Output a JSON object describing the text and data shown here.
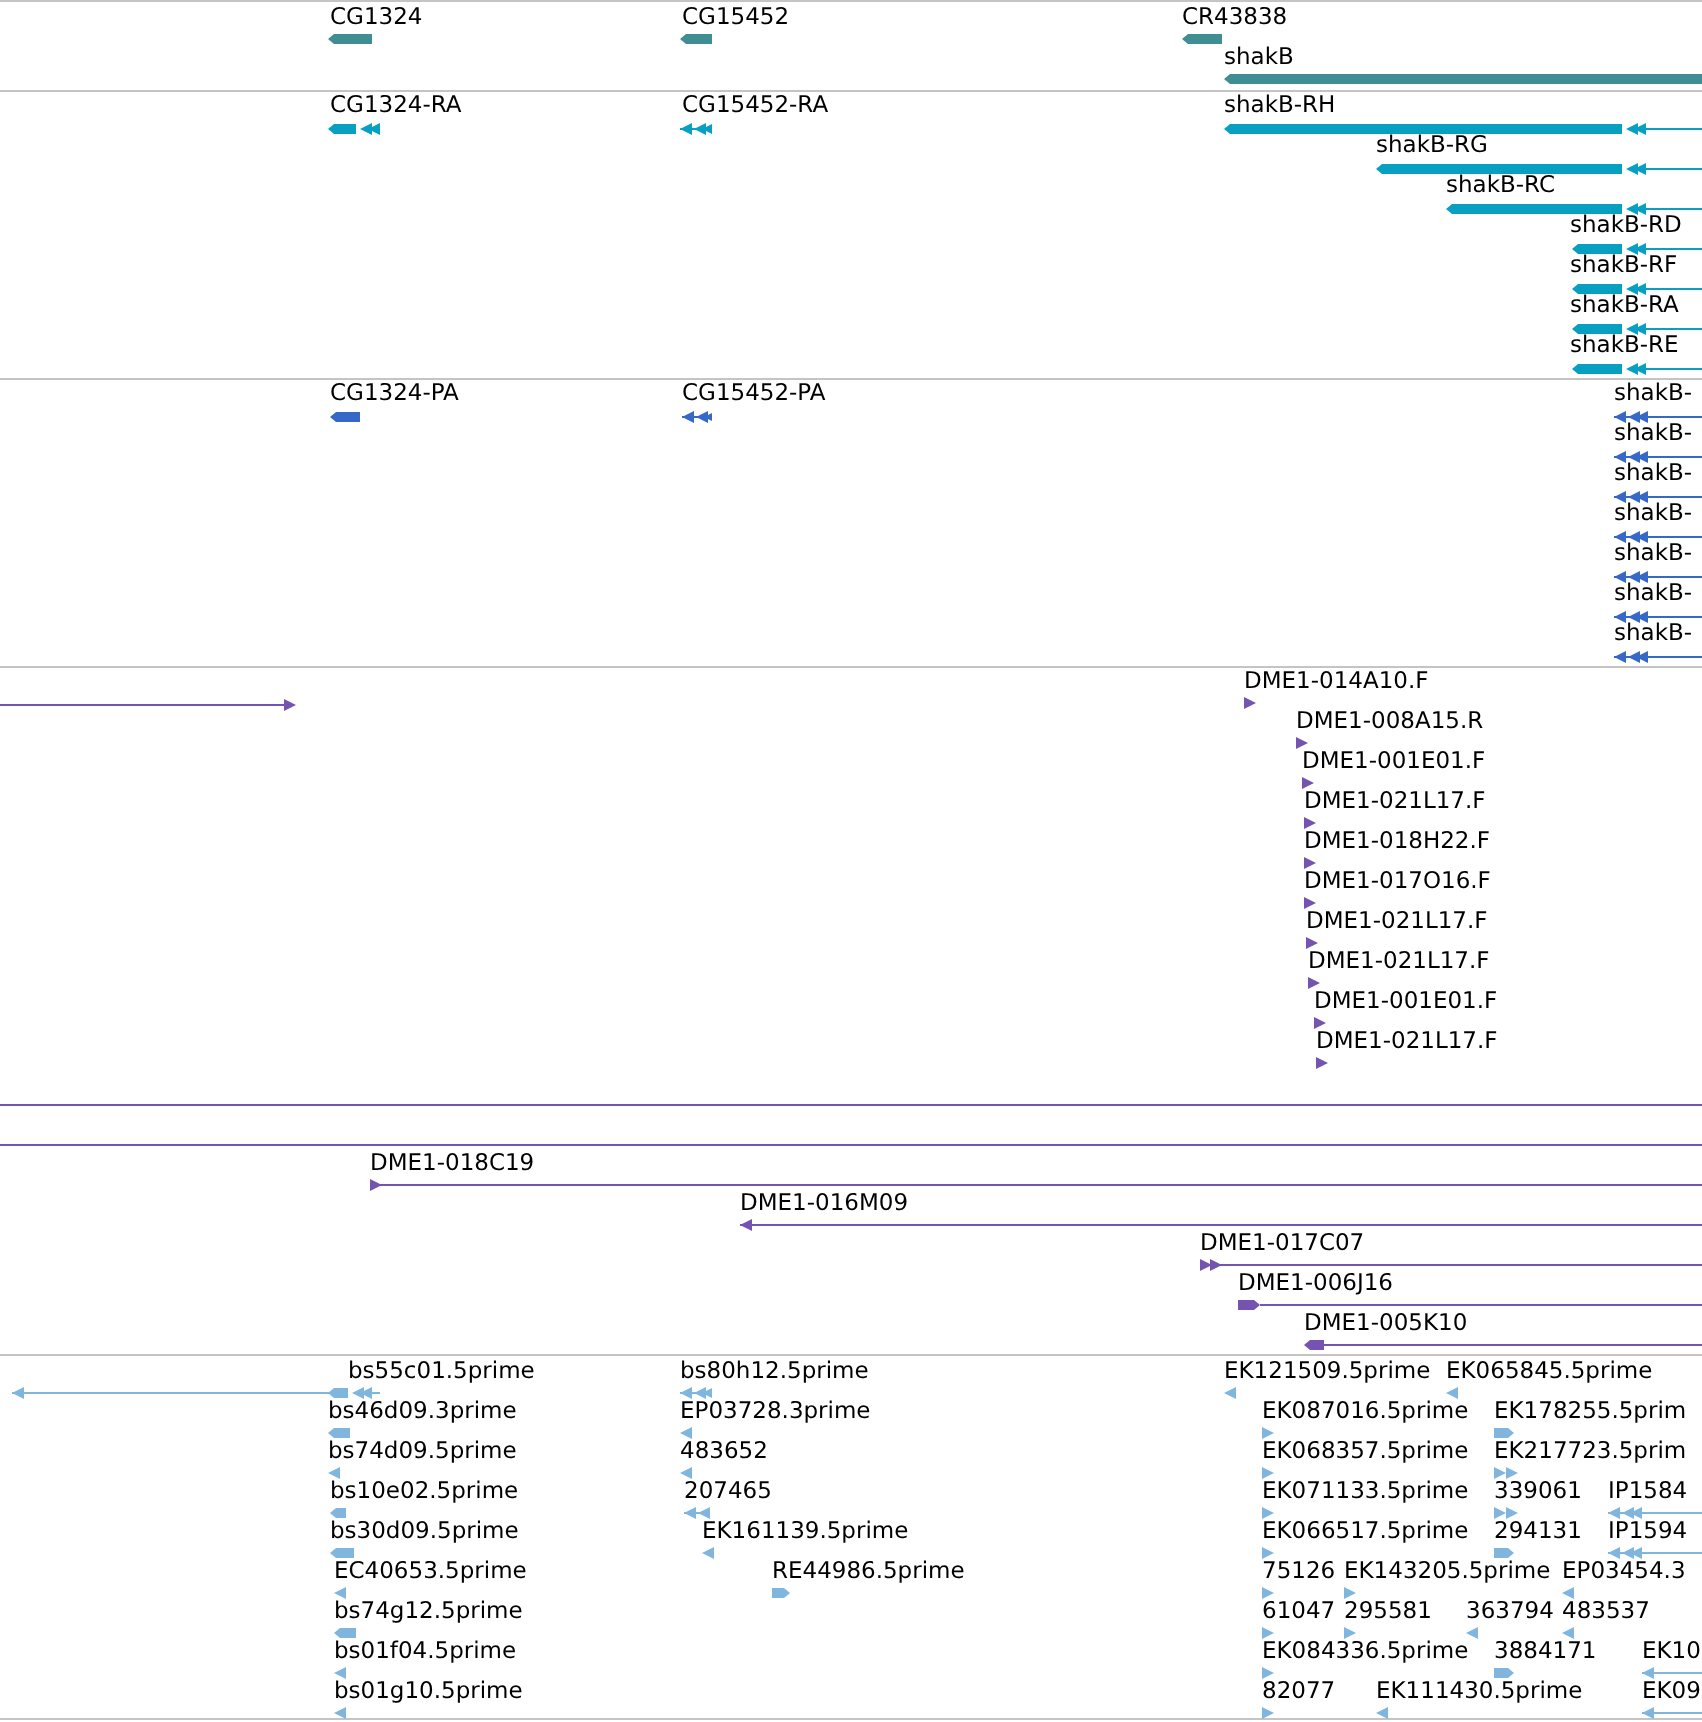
{
  "tracks": [
    {
      "color": "#3e8e94",
      "features": [
        {
          "label": "CG1324"
        },
        {
          "label": "CG15452"
        },
        {
          "label": "CR43838"
        },
        {
          "label": "shakB"
        }
      ]
    },
    {
      "color": "#08a0c2",
      "features": [
        {
          "label": "CG1324-RA"
        },
        {
          "label": "CG15452-RA"
        },
        {
          "label": "shakB-RH"
        },
        {
          "label": "shakB-RG"
        },
        {
          "label": "shakB-RC"
        },
        {
          "label": "shakB-RD"
        },
        {
          "label": "shakB-RF"
        },
        {
          "label": "shakB-RA"
        },
        {
          "label": "shakB-RE"
        }
      ]
    },
    {
      "color": "#3668c8",
      "features": [
        {
          "label": "CG1324-PA"
        },
        {
          "label": "CG15452-PA"
        },
        {
          "label": "shakB-"
        },
        {
          "label": "shakB-"
        },
        {
          "label": "shakB-"
        },
        {
          "label": "shakB-"
        },
        {
          "label": "shakB-"
        },
        {
          "label": "shakB-"
        },
        {
          "label": "shakB-"
        }
      ]
    },
    {
      "color": "#7553b0",
      "features": [
        {
          "label": "DME1-014A10.F"
        },
        {
          "label": "DME1-008A15.R"
        },
        {
          "label": "DME1-001E01.F"
        },
        {
          "label": "DME1-021L17.F"
        },
        {
          "label": "DME1-018H22.F"
        },
        {
          "label": "DME1-017O16.F"
        },
        {
          "label": "DME1-021L17.F"
        },
        {
          "label": "DME1-021L17.F"
        },
        {
          "label": "DME1-001E01.F"
        },
        {
          "label": "DME1-021L17.F"
        },
        {
          "label": "DME1-018C19"
        },
        {
          "label": "DME1-016M09"
        },
        {
          "label": "DME1-017C07"
        },
        {
          "label": "DME1-006J16"
        },
        {
          "label": "DME1-005K10"
        }
      ]
    },
    {
      "color": "#80b6de",
      "features": [
        {
          "label": "bs55c01.5prime"
        },
        {
          "label": "bs80h12.5prime"
        },
        {
          "label": "EK121509.5prime"
        },
        {
          "label": "EK065845.5prime"
        },
        {
          "label": "bs46d09.3prime"
        },
        {
          "label": "EP03728.3prime"
        },
        {
          "label": "EK087016.5prime"
        },
        {
          "label": "EK178255.5prim"
        },
        {
          "label": "bs74d09.5prime"
        },
        {
          "label": "483652"
        },
        {
          "label": "EK068357.5prime"
        },
        {
          "label": "EK217723.5prim"
        },
        {
          "label": "bs10e02.5prime"
        },
        {
          "label": "207465"
        },
        {
          "label": "EK071133.5prime"
        },
        {
          "label": "339061"
        },
        {
          "label": "IP1584"
        },
        {
          "label": "bs30d09.5prime"
        },
        {
          "label": "EK161139.5prime"
        },
        {
          "label": "EK066517.5prime"
        },
        {
          "label": "294131"
        },
        {
          "label": "IP1594"
        },
        {
          "label": "EC40653.5prime"
        },
        {
          "label": "RE44986.5prime"
        },
        {
          "label": "75126"
        },
        {
          "label": "EK143205.5prime"
        },
        {
          "label": "EP03454.3"
        },
        {
          "label": "bs74g12.5prime"
        },
        {
          "label": "61047"
        },
        {
          "label": "295581"
        },
        {
          "label": "363794"
        },
        {
          "label": "483537"
        },
        {
          "label": "bs01f04.5prime"
        },
        {
          "label": "EK084336.5prime"
        },
        {
          "label": "3884171"
        },
        {
          "label": "EK10"
        },
        {
          "label": "bs01g10.5prime"
        },
        {
          "label": "82077"
        },
        {
          "label": "EK111430.5prime"
        },
        {
          "label": "EK09"
        }
      ]
    }
  ]
}
